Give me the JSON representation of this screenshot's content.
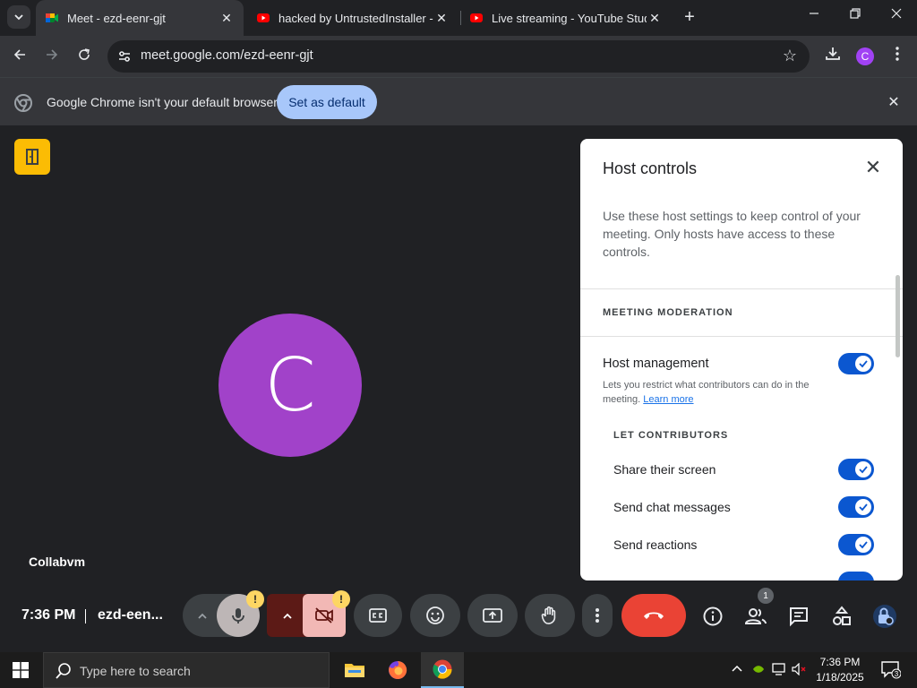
{
  "browser": {
    "tabs": [
      {
        "title": "Meet - ezd-eenr-gjt",
        "active": true
      },
      {
        "title": "hacked by UntrustedInstaller - Y",
        "active": false
      },
      {
        "title": "Live streaming - YouTube Studio",
        "active": false
      }
    ],
    "url": "meet.google.com/ezd-eenr-gjt",
    "profile_initial": "C",
    "infobar": {
      "message": "Google Chrome isn't your default browser",
      "button": "Set as default"
    }
  },
  "meet": {
    "avatar_initial": "C",
    "participant_name": "Collabvm",
    "time": "7:36 PM",
    "meeting_code": "ezd-een...",
    "mic_warning": "!",
    "cam_warning": "!",
    "people_count": "1"
  },
  "host_controls": {
    "title": "Host controls",
    "description": "Use these host settings to keep control of your meeting. Only hosts have access to these controls.",
    "section_moderation": "MEETING MODERATION",
    "host_management": {
      "label": "Host management",
      "sub": "Lets you restrict what contributors can do in the meeting.",
      "link": "Learn more",
      "on": true
    },
    "section_contributors": "LET CONTRIBUTORS",
    "options": [
      {
        "label": "Share their screen",
        "on": true
      },
      {
        "label": "Send chat messages",
        "on": true
      },
      {
        "label": "Send reactions",
        "on": true
      }
    ]
  },
  "taskbar": {
    "search_placeholder": "Type here to search",
    "time": "7:36 PM",
    "date": "1/18/2025",
    "notification_count": "3"
  },
  "colors": {
    "toggle_on": "#0b57d0",
    "end_call": "#ea4335",
    "avatar": "#a142c9",
    "warning": "#fdd663"
  }
}
